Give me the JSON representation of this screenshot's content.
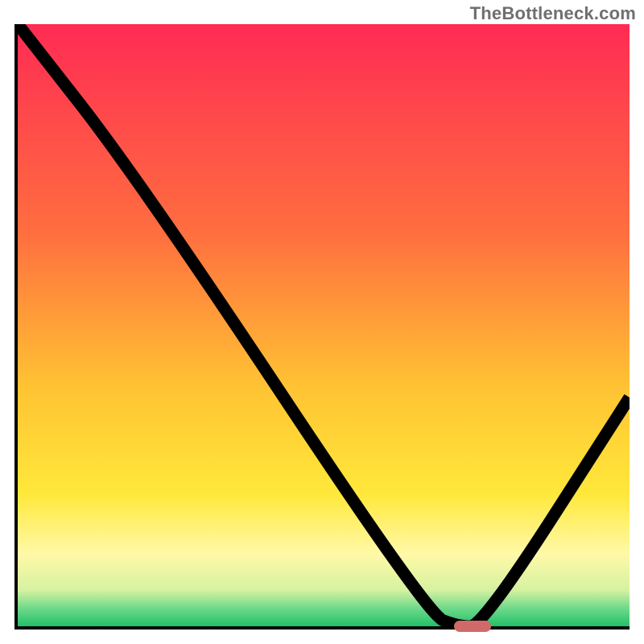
{
  "watermark": "TheBottleneck.com",
  "chart_data": {
    "type": "line",
    "title": "",
    "xlabel": "",
    "ylabel": "",
    "xlim": [
      0,
      100
    ],
    "ylim": [
      0,
      100
    ],
    "x": [
      0,
      20,
      67,
      72,
      76,
      100
    ],
    "values": [
      100,
      74,
      2,
      0,
      0,
      38
    ],
    "grid": false,
    "legend": false
  },
  "gradient_stops": [
    {
      "pct": 0,
      "color": "#ff2b54"
    },
    {
      "pct": 35,
      "color": "#ff6f3f"
    },
    {
      "pct": 60,
      "color": "#ffc233"
    },
    {
      "pct": 78,
      "color": "#ffe83a"
    },
    {
      "pct": 88,
      "color": "#fff9a8"
    },
    {
      "pct": 94,
      "color": "#d6f2a0"
    },
    {
      "pct": 97,
      "color": "#6fd98a"
    },
    {
      "pct": 100,
      "color": "#22c06a"
    }
  ],
  "marker": {
    "x_start": 71,
    "x_end": 77,
    "y": 0,
    "color": "#cf6a69"
  }
}
